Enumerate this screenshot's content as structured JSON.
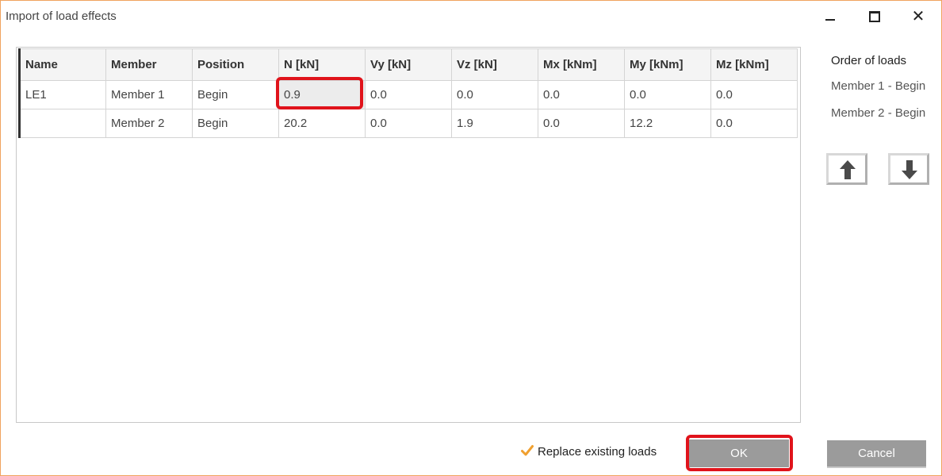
{
  "window": {
    "title": "Import of load effects",
    "close_glyph": "✕"
  },
  "table": {
    "headers": [
      "Name",
      "Member",
      "Position",
      "N [kN]",
      "Vy [kN]",
      "Vz [kN]",
      "Mx [kNm]",
      "My [kNm]",
      "Mz [kNm]"
    ],
    "rows": [
      [
        "LE1",
        "Member 1",
        "Begin",
        "0.9",
        "0.0",
        "0.0",
        "0.0",
        "0.0",
        "0.0"
      ],
      [
        "",
        "Member 2",
        "Begin",
        "20.2",
        "0.0",
        "1.9",
        "0.0",
        "12.2",
        "0.0"
      ]
    ]
  },
  "order": {
    "title": "Order of loads",
    "items": [
      "Member 1 - Begin",
      "Member 2 - Begin"
    ]
  },
  "icons": {
    "up": "arrow-up-icon",
    "down": "arrow-down-icon",
    "check": "checkmark-icon"
  },
  "footer": {
    "replace_label": "Replace existing loads",
    "replace_checked": true,
    "ok_label": "OK",
    "cancel_label": "Cancel"
  },
  "colors": {
    "highlight": "#e0131b",
    "check": "#f0a030",
    "button": "#9b9b9b"
  }
}
